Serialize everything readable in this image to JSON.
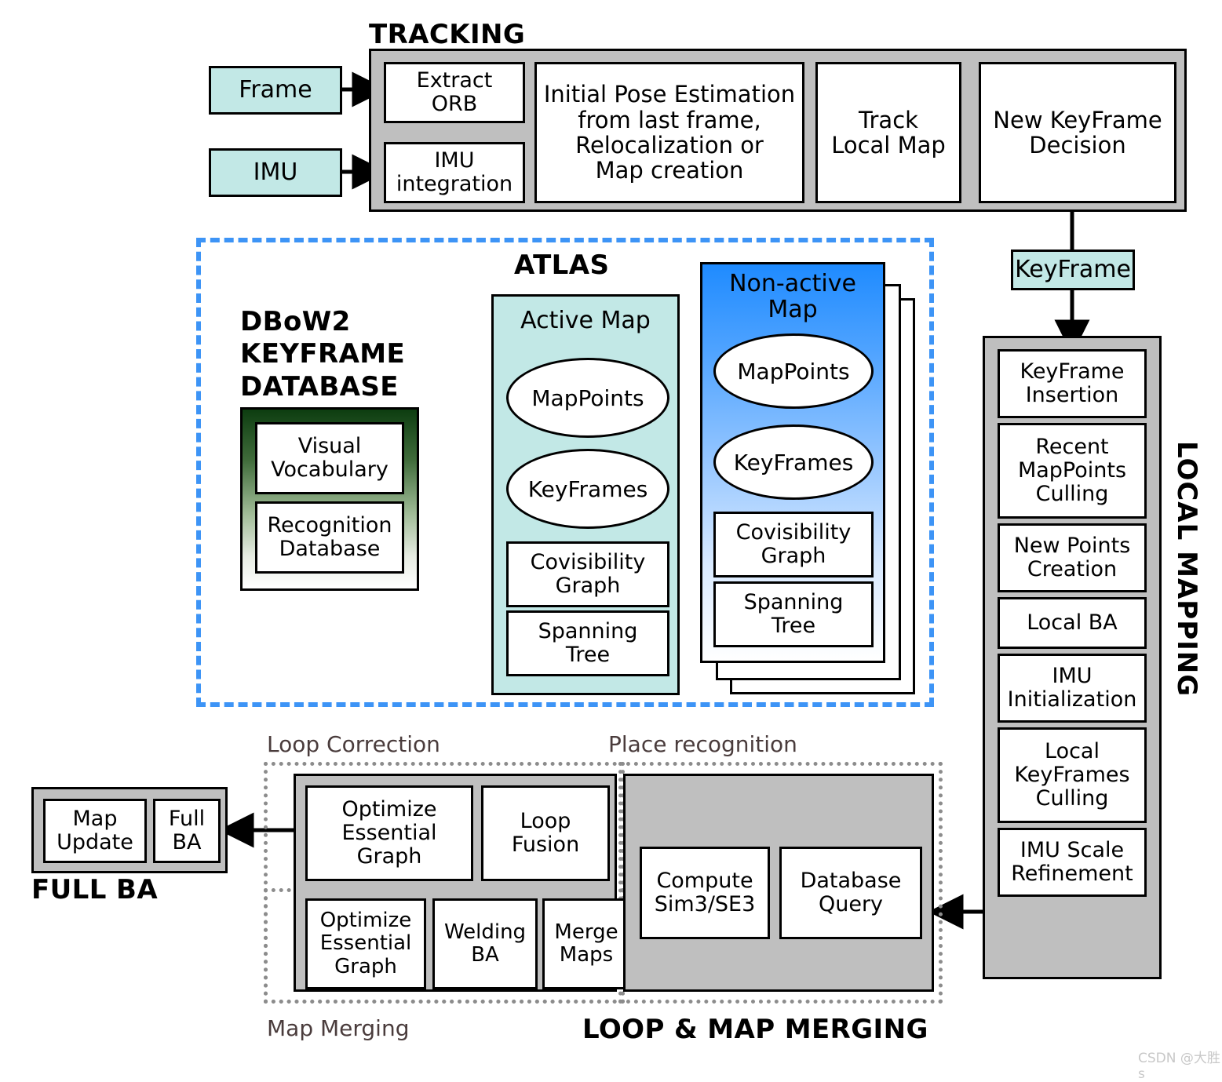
{
  "diagram": {
    "title_tracking": "TRACKING",
    "title_atlas": "ATLAS",
    "title_local_mapping": "LOCAL MAPPING",
    "title_loop_map_merging": "LOOP & MAP MERGING",
    "title_full_ba": "FULL BA",
    "label_loop_correction": "Loop Correction",
    "label_map_merging": "Map Merging",
    "label_place_recognition": "Place recognition",
    "watermark": "CSDN @大胜s"
  },
  "inputs": {
    "frame": "Frame",
    "imu": "IMU",
    "keyframe": "KeyFrame"
  },
  "tracking": {
    "extract_orb": "Extract\nORB",
    "imu_integration": "IMU\nintegration",
    "initial_pose": "Initial Pose Estimation\nfrom last frame,\nRelocalization or\nMap creation",
    "track_local_map": "Track\nLocal Map",
    "new_keyframe_decision": "New KeyFrame\nDecision"
  },
  "dbow2": {
    "heading": "DBoW2\nKEYFRAME\nDATABASE",
    "visual_vocabulary": "Visual\nVocabulary",
    "recognition_database": "Recognition\nDatabase"
  },
  "active_map": {
    "label": "Active Map",
    "mappoints": "MapPoints",
    "keyframes": "KeyFrames",
    "covisibility_graph": "Covisibility\nGraph",
    "spanning_tree": "Spanning\nTree"
  },
  "nonactive_map": {
    "label": "Non-active\nMap",
    "mappoints": "MapPoints",
    "keyframes": "KeyFrames",
    "covisibility_graph": "Covisibility\nGraph",
    "spanning_tree": "Spanning\nTree"
  },
  "local_mapping": {
    "items": [
      "KeyFrame\nInsertion",
      "Recent\nMapPoints\nCulling",
      "New Points\nCreation",
      "Local BA",
      "IMU\nInitialization",
      "Local\nKeyFrames\nCulling",
      "IMU Scale\nRefinement"
    ]
  },
  "loop_correction": {
    "optimize_essential_graph": "Optimize\nEssential\nGraph",
    "loop_fusion": "Loop\nFusion"
  },
  "map_merging": {
    "optimize_essential_graph": "Optimize\nEssential\nGraph",
    "welding_ba": "Welding\nBA",
    "merge_maps": "Merge\nMaps"
  },
  "place_recognition": {
    "compute_sim3": "Compute\nSim3/SE3",
    "database_query": "Database\nQuery"
  },
  "full_ba": {
    "map_update": "Map\nUpdate",
    "full_ba": "Full\nBA"
  },
  "colors": {
    "cyan": "#c2e8e6",
    "gray_panel": "#bfbfbf",
    "atlas_dash": "#3d94f6",
    "nonactive_blue": "#2a8fff",
    "dbow_green": "#0d3d10",
    "dotted_gray": "#8c8c8c",
    "label_brown": "#4a3c3c"
  }
}
